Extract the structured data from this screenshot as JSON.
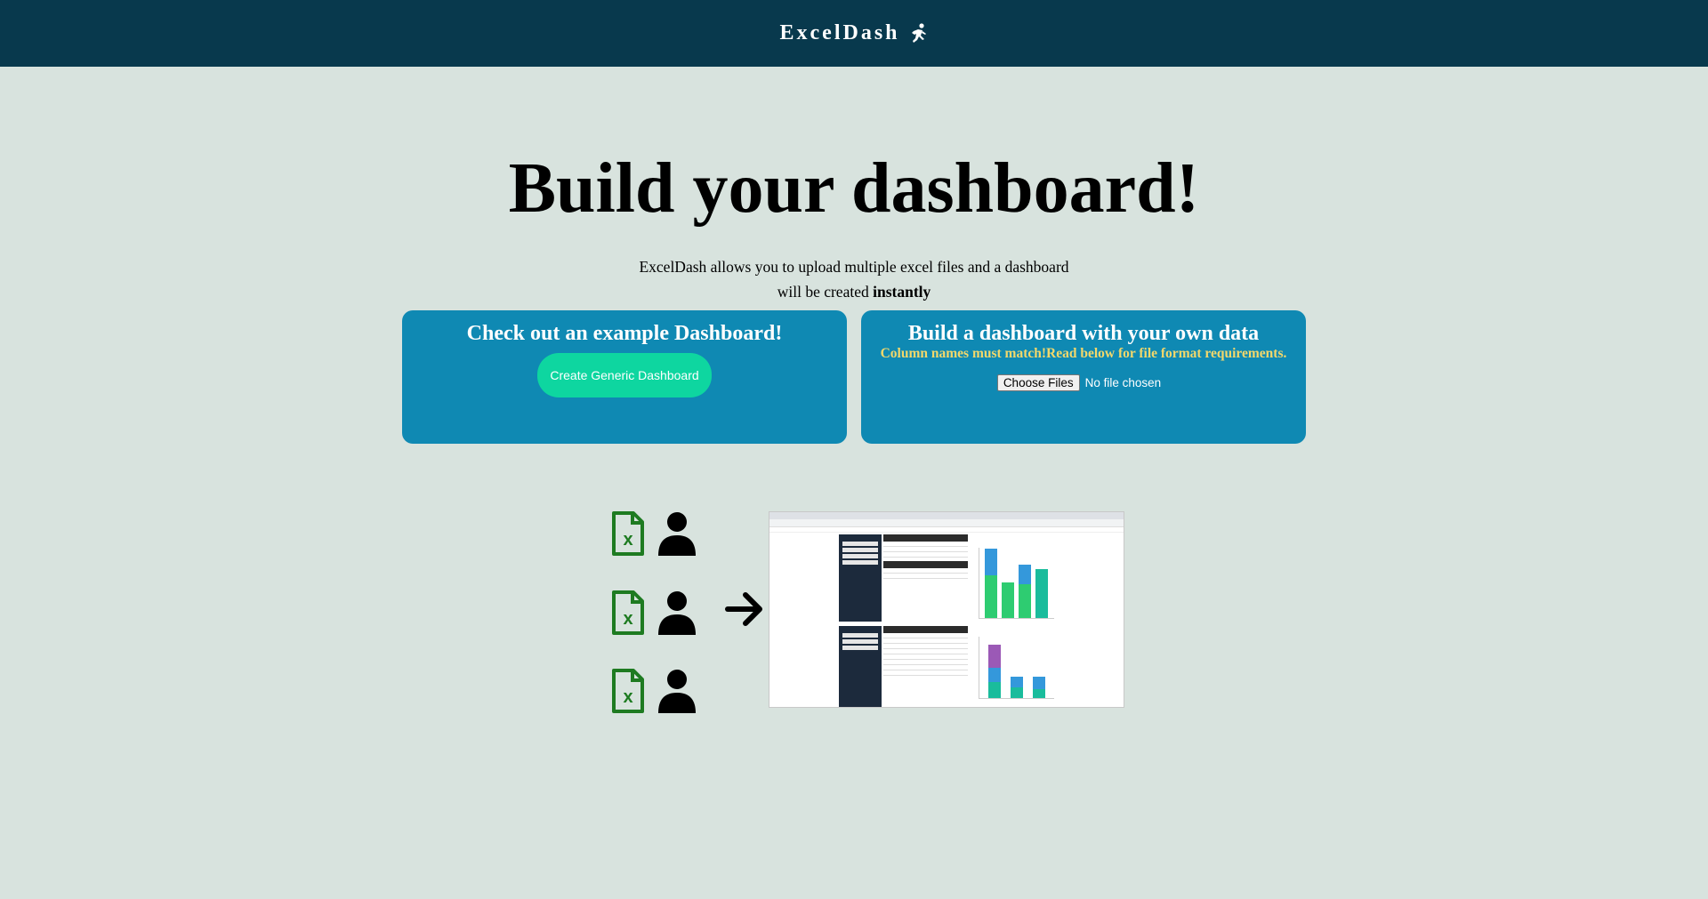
{
  "navbar": {
    "brand": "ExcelDash",
    "brand_icon": "running-person-icon"
  },
  "hero": {
    "title": "Build your dashboard!",
    "subtitle_line1": "ExcelDash allows you to upload multiple excel files and a dashboard",
    "subtitle_line2_prefix": "will be created ",
    "subtitle_line2_bold": "instantly"
  },
  "example_card": {
    "heading": "Check out an example Dashboard!",
    "button_label": "Create Generic Dashboard"
  },
  "upload_card": {
    "heading": "Build a dashboard with your own data",
    "warning": "Column names must match!Read below for file format requirements.",
    "choose_files_label": "Choose Files",
    "file_status": "No file chosen"
  },
  "illustration": {
    "icons": [
      "excel-file-icon",
      "person-icon",
      "arrow-right-icon"
    ],
    "colors": {
      "excel_green": "#1e7b21",
      "person_black": "#000000"
    }
  },
  "colors": {
    "navbar": "#08394d",
    "background": "#d8e3de",
    "card": "#0f89b3",
    "button": "#0ed6a0",
    "warning_text": "#f3d86b"
  }
}
